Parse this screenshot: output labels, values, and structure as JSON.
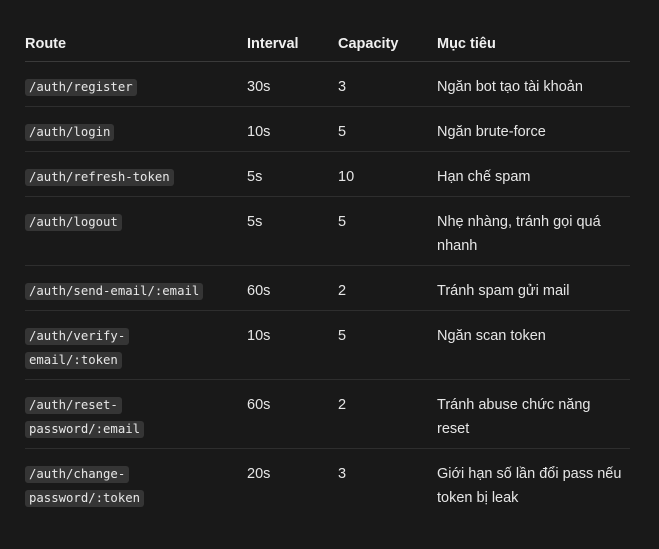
{
  "table": {
    "headers": [
      "Route",
      "Interval",
      "Capacity",
      "Mục tiêu"
    ],
    "rows": [
      {
        "route": "/auth/register",
        "interval": "30s",
        "capacity": "3",
        "goal": "Ngăn bot tạo tài khoản"
      },
      {
        "route": "/auth/login",
        "interval": "10s",
        "capacity": "5",
        "goal": "Ngăn brute-force"
      },
      {
        "route": "/auth/refresh-token",
        "interval": "5s",
        "capacity": "10",
        "goal": "Hạn chế spam"
      },
      {
        "route": "/auth/logout",
        "interval": "5s",
        "capacity": "5",
        "goal": "Nhẹ nhàng, tránh gọi quá nhanh"
      },
      {
        "route": "/auth/send-email/:email",
        "interval": "60s",
        "capacity": "2",
        "goal": "Tránh spam gửi mail"
      },
      {
        "route_line1": "/auth/verify-",
        "route_line2": "email/:token",
        "interval": "10s",
        "capacity": "5",
        "goal": "Ngăn scan token"
      },
      {
        "route_line1": "/auth/reset-",
        "route_line2": "password/:email",
        "interval": "60s",
        "capacity": "2",
        "goal": "Tránh abuse chức năng reset"
      },
      {
        "route_line1": "/auth/change-",
        "route_line2": "password/:token",
        "interval": "20s",
        "capacity": "3",
        "goal": "Giới hạn số lần đổi pass nếu token bị leak"
      }
    ]
  }
}
